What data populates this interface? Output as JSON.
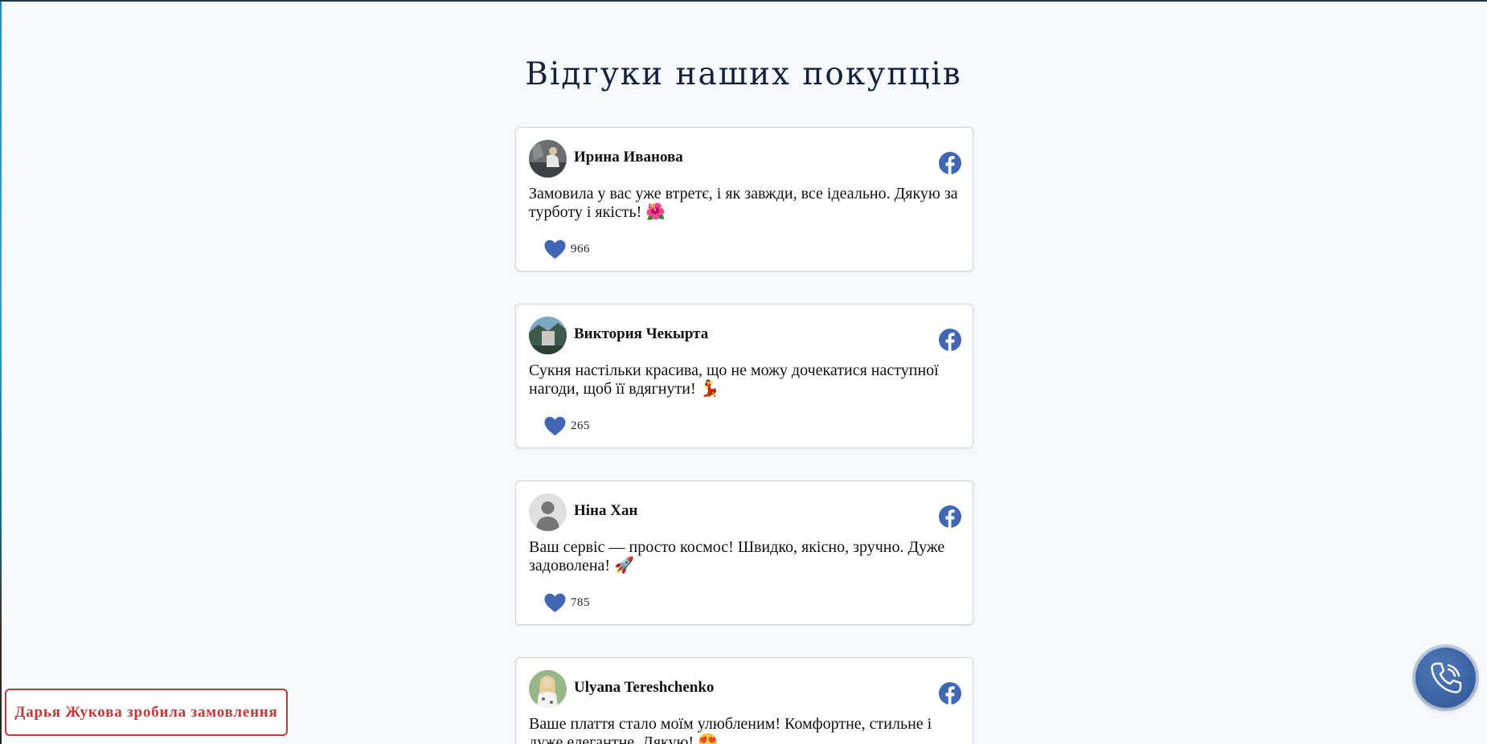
{
  "page_title": "Відгуки наших покупців",
  "colors": {
    "accent": "#4267b2",
    "toast": "#c8363a",
    "title": "#14213d",
    "call_button": "#2d5597"
  },
  "reviews": [
    {
      "name": "Ирина Иванова",
      "text": "Замовила у вас уже втретє, і як завжди, все ідеально. Дякую за турботу і якість! 🌺",
      "likes": "966",
      "avatar": "photo"
    },
    {
      "name": "Виктория Чекырта",
      "text": "Сукня настільки красива, що не можу дочекатися наступної нагоди, щоб її вдягнути! 💃",
      "likes": "265",
      "avatar": "photo"
    },
    {
      "name": "Ніна Хан",
      "text": "Ваш сервіс — просто космос! Швидко, якісно, зручно. Дуже задоволена! 🚀",
      "likes": "785",
      "avatar": "default-user-icon"
    },
    {
      "name": "Ulyana Tereshchenko",
      "text": "Ваше плаття стало моїм улюбленим! Комфортне, стильне і дуже елегантне. Дякую! 😍",
      "avatar": "photo"
    }
  ],
  "icons": {
    "social": "facebook-icon",
    "like": "heart-icon",
    "call": "phone-icon"
  },
  "toast": {
    "text": "Дарья Жукова зробила замовлення"
  }
}
